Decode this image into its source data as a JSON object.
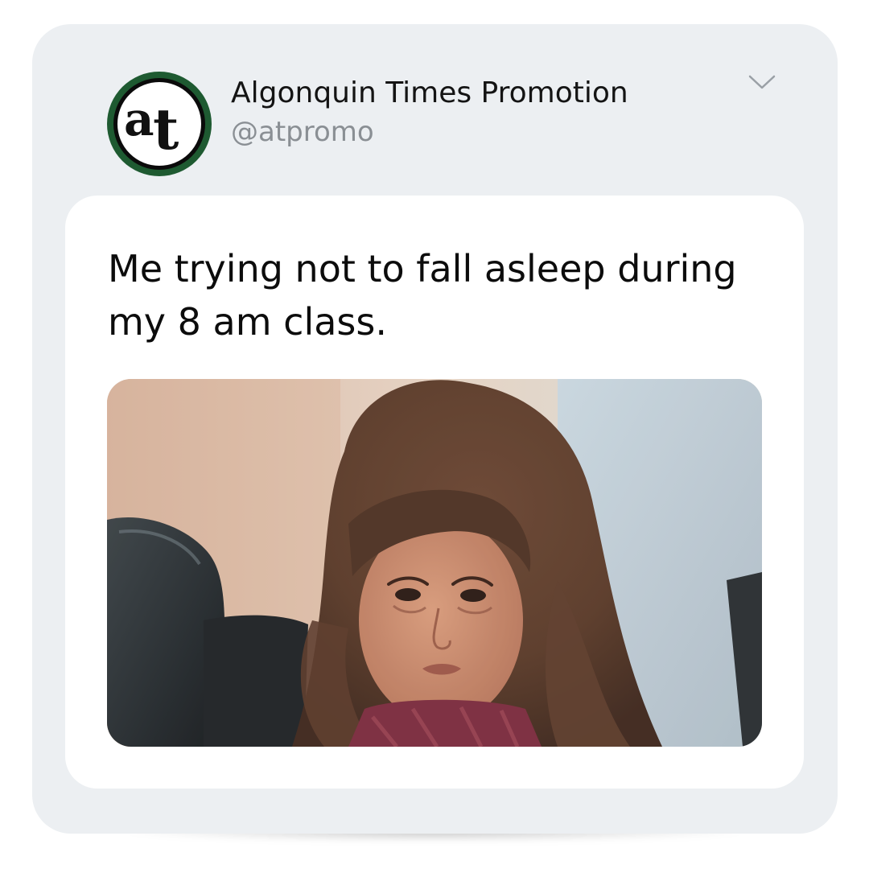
{
  "post": {
    "author_name": "Algonquin Times Promotion",
    "author_handle": "@atpromo",
    "avatar_monogram": "at",
    "avatar_icon": "at-monogram-logo",
    "menu_icon": "chevron-down-icon",
    "text": "Me trying not to fall asleep during my 8 am class.",
    "image_icon": "meme-photo-sleepy-child"
  },
  "colors": {
    "card_background": "#eceff2",
    "content_background": "#ffffff",
    "avatar_ring": "#1e5a31",
    "name_text": "#141414",
    "handle_text": "#8a8f94"
  }
}
